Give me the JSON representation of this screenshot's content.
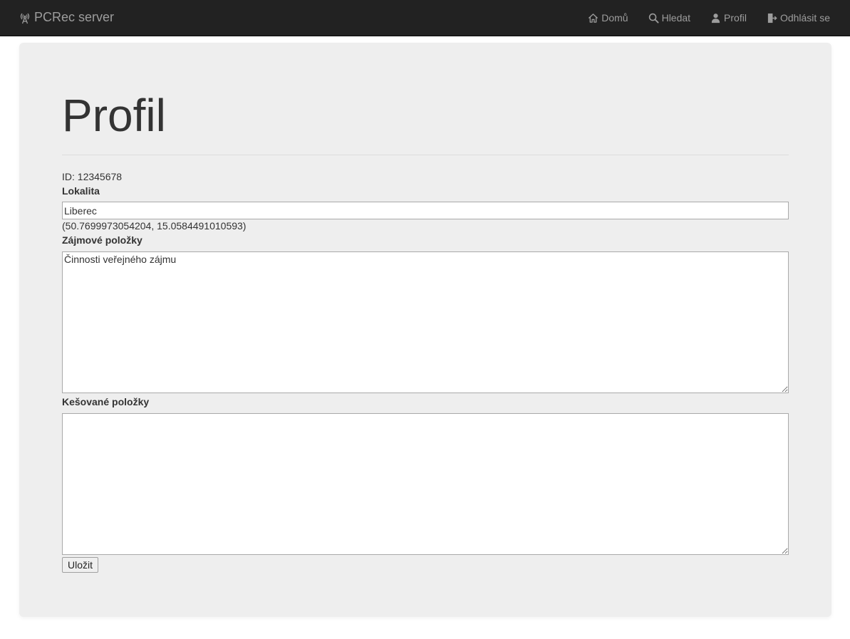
{
  "app": {
    "brand": "PCRec server",
    "brand_icon": "radio-tower-icon"
  },
  "nav": {
    "items": [
      {
        "label": "Domů",
        "icon": "home-icon"
      },
      {
        "label": "Hledat",
        "icon": "search-icon"
      },
      {
        "label": "Profil",
        "icon": "user-icon"
      },
      {
        "label": "Odhlásit se",
        "icon": "logout-icon"
      }
    ]
  },
  "page": {
    "title": "Profil",
    "id_line": "ID: 12345678",
    "location_label": "Lokalita",
    "location_value": "Liberec",
    "coordinates": "(50.7699973054204, 15.0584491010593)",
    "interests_label": "Zájmové položky",
    "interests_value": "Činnosti veřejného zájmu",
    "cached_label": "Kešované položky",
    "cached_value": "",
    "save_label": "Uložit"
  },
  "colors": {
    "navbar_bg": "#222222",
    "nav_text": "#9d9d9d",
    "jumbotron_bg": "#eeeeee",
    "text": "#333333"
  }
}
